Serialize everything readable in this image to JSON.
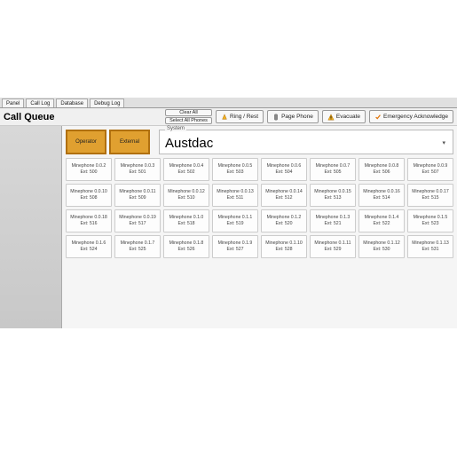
{
  "tabs": [
    {
      "label": "Panel"
    },
    {
      "label": "Call Log"
    },
    {
      "label": "Database"
    },
    {
      "label": "Debug Log"
    }
  ],
  "title": "Call Queue",
  "toolbar": {
    "clear_all": "Clear All",
    "select_all": "Select All Phones",
    "ring_reset": "Ring / Rest",
    "page_phone": "Page Phone",
    "evacuate": "Evacuate",
    "emergency_ack": "Emergency Acknowledge"
  },
  "category": {
    "operator": "Operator",
    "external": "External"
  },
  "system": {
    "label": "System",
    "value": "Austdac"
  },
  "phones": [
    {
      "name": "Minephone 0.0.2",
      "ext": "Ext: 500"
    },
    {
      "name": "Minephone 0.0.3",
      "ext": "Ext: 501"
    },
    {
      "name": "Minephone 0.0.4",
      "ext": "Ext: 502"
    },
    {
      "name": "Minephone 0.0.5",
      "ext": "Ext: 503"
    },
    {
      "name": "Minephone 0.0.6",
      "ext": "Ext: 504"
    },
    {
      "name": "Minephone 0.0.7",
      "ext": "Ext: 505"
    },
    {
      "name": "Minephone 0.0.8",
      "ext": "Ext: 506"
    },
    {
      "name": "Minephone 0.0.9",
      "ext": "Ext: 507"
    },
    {
      "name": "Minephone 0.0.10",
      "ext": "Ext: 508"
    },
    {
      "name": "Minephone 0.0.11",
      "ext": "Ext: 509"
    },
    {
      "name": "Minephone 0.0.12",
      "ext": "Ext: 510"
    },
    {
      "name": "Minephone 0.0.13",
      "ext": "Ext: 511"
    },
    {
      "name": "Minephone 0.0.14",
      "ext": "Ext: 512"
    },
    {
      "name": "Minephone 0.0.15",
      "ext": "Ext: 513"
    },
    {
      "name": "Minephone 0.0.16",
      "ext": "Ext: 514"
    },
    {
      "name": "Minephone 0.0.17",
      "ext": "Ext: 515"
    },
    {
      "name": "Minephone 0.0.18",
      "ext": "Ext: 516"
    },
    {
      "name": "Minephone 0.0.19",
      "ext": "Ext: 517"
    },
    {
      "name": "Minephone 0.1.0",
      "ext": "Ext: 518"
    },
    {
      "name": "Minephone 0.1.1",
      "ext": "Ext: 519"
    },
    {
      "name": "Minephone 0.1.2",
      "ext": "Ext: 520"
    },
    {
      "name": "Minephone 0.1.3",
      "ext": "Ext: 521"
    },
    {
      "name": "Minephone 0.1.4",
      "ext": "Ext: 522"
    },
    {
      "name": "Minephone 0.1.5",
      "ext": "Ext: 523"
    },
    {
      "name": "Minephone 0.1.6",
      "ext": "Ext: 524"
    },
    {
      "name": "Minephone 0.1.7",
      "ext": "Ext: 525"
    },
    {
      "name": "Minephone 0.1.8",
      "ext": "Ext: 526"
    },
    {
      "name": "Minephone 0.1.9",
      "ext": "Ext: 527"
    },
    {
      "name": "Minephone 0.1.10",
      "ext": "Ext: 528"
    },
    {
      "name": "Minephone 0.1.11",
      "ext": "Ext: 529"
    },
    {
      "name": "Minephone 0.1.12",
      "ext": "Ext: 530"
    },
    {
      "name": "Minephone 0.1.13",
      "ext": "Ext: 531"
    }
  ]
}
